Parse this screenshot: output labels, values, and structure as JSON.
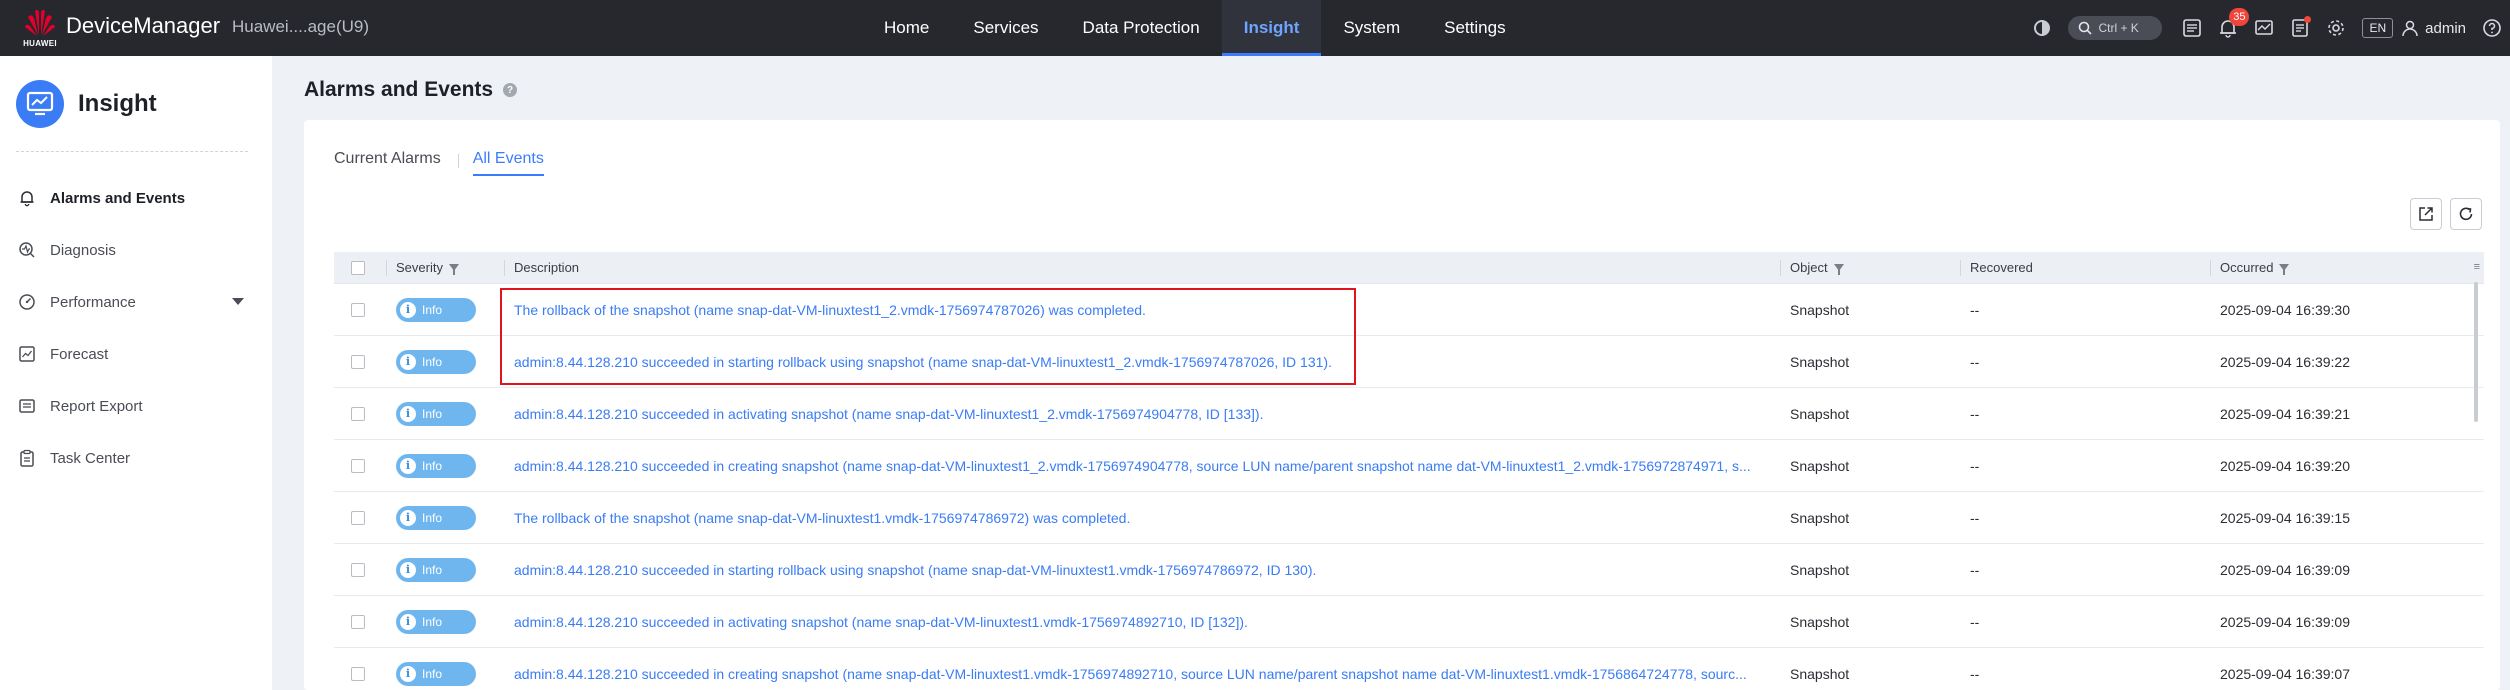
{
  "header": {
    "brand": "HUAWEI",
    "app_title": "DeviceManager",
    "device_name": "Huawei....age(U9)",
    "nav": [
      "Home",
      "Services",
      "Data Protection",
      "Insight",
      "System",
      "Settings"
    ],
    "active_nav": "Insight",
    "search_shortcut": "Ctrl + K",
    "alarm_count": "35",
    "language": "EN",
    "user": "admin"
  },
  "sidebar": {
    "title": "Insight",
    "items": [
      {
        "label": "Alarms and Events",
        "icon": "bell-icon"
      },
      {
        "label": "Diagnosis",
        "icon": "diagnosis-icon"
      },
      {
        "label": "Performance",
        "icon": "gauge-icon"
      },
      {
        "label": "Forecast",
        "icon": "forecast-chart-icon"
      },
      {
        "label": "Report Export",
        "icon": "report-icon"
      },
      {
        "label": "Task Center",
        "icon": "clipboard-icon"
      }
    ]
  },
  "main": {
    "page_title": "Alarms and Events",
    "tabs": [
      "Current Alarms",
      "All Events"
    ],
    "active_tab": "All Events",
    "table": {
      "headers": {
        "severity": "Severity",
        "description": "Description",
        "object": "Object",
        "recovered": "Recovered",
        "occurred": "Occurred"
      },
      "rows": [
        {
          "severity": "Info",
          "description": "The rollback of the snapshot (name snap-dat-VM-linuxtest1_2.vmdk-1756974787026) was completed.",
          "object": "Snapshot",
          "recovered": "--",
          "occurred": "2025-09-04 16:39:30"
        },
        {
          "severity": "Info",
          "description": "admin:8.44.128.210 succeeded in starting rollback using snapshot (name snap-dat-VM-linuxtest1_2.vmdk-1756974787026, ID 131).",
          "object": "Snapshot",
          "recovered": "--",
          "occurred": "2025-09-04 16:39:22"
        },
        {
          "severity": "Info",
          "description": "admin:8.44.128.210 succeeded in activating snapshot (name snap-dat-VM-linuxtest1_2.vmdk-1756974904778, ID [133]).",
          "object": "Snapshot",
          "recovered": "--",
          "occurred": "2025-09-04 16:39:21"
        },
        {
          "severity": "Info",
          "description": "admin:8.44.128.210 succeeded in creating snapshot (name snap-dat-VM-linuxtest1_2.vmdk-1756974904778, source LUN name/parent snapshot name dat-VM-linuxtest1_2.vmdk-1756972874971, s...",
          "object": "Snapshot",
          "recovered": "--",
          "occurred": "2025-09-04 16:39:20"
        },
        {
          "severity": "Info",
          "description": "The rollback of the snapshot (name snap-dat-VM-linuxtest1.vmdk-1756974786972) was completed.",
          "object": "Snapshot",
          "recovered": "--",
          "occurred": "2025-09-04 16:39:15"
        },
        {
          "severity": "Info",
          "description": "admin:8.44.128.210 succeeded in starting rollback using snapshot (name snap-dat-VM-linuxtest1.vmdk-1756974786972, ID 130).",
          "object": "Snapshot",
          "recovered": "--",
          "occurred": "2025-09-04 16:39:09"
        },
        {
          "severity": "Info",
          "description": "admin:8.44.128.210 succeeded in activating snapshot (name snap-dat-VM-linuxtest1.vmdk-1756974892710, ID [132]).",
          "object": "Snapshot",
          "recovered": "--",
          "occurred": "2025-09-04 16:39:09"
        },
        {
          "severity": "Info",
          "description": "admin:8.44.128.210 succeeded in creating snapshot (name snap-dat-VM-linuxtest1.vmdk-1756974892710, source LUN name/parent snapshot name dat-VM-linuxtest1.vmdk-1756864724778, sourc...",
          "object": "Snapshot",
          "recovered": "--",
          "occurred": "2025-09-04 16:39:07"
        }
      ]
    }
  },
  "colors": {
    "topbar": "#26282e",
    "accent": "#3b7cff",
    "severity_info": "#6fb6ee",
    "highlight": "#e0141e"
  }
}
